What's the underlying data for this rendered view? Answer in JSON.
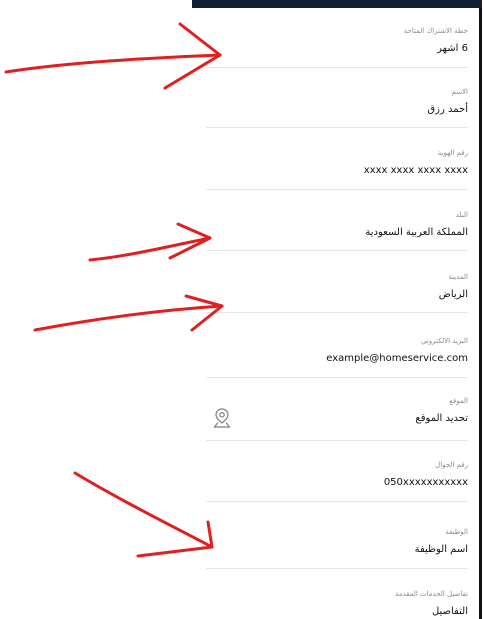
{
  "form": {
    "fields": [
      {
        "label": "خطة الاشتراك المتاحة",
        "value": "6 اشهر"
      },
      {
        "label": "الاسم",
        "value": "أحمد رزق"
      },
      {
        "label": "رقم الهوية",
        "value": "xxxx  xxxx  xxxx  xxxx"
      },
      {
        "label": "البلد",
        "value": "المملكة العربية السعودية"
      },
      {
        "label": "المدينة",
        "value": "الرياض"
      },
      {
        "label": "البريد الالكتروني",
        "value": "example@homeservice.com"
      },
      {
        "label": "الموقع",
        "value": "تحديد الموقع"
      },
      {
        "label": "رقم الجوال",
        "value": "050xxxxxxxxxxx"
      },
      {
        "label": "الوظيفة",
        "value": "اسم الوظيفة"
      },
      {
        "label": "تفاصيل الخدمات المقدمة",
        "value": "التفاصيل"
      }
    ]
  },
  "icons": {
    "location": "map-pin-icon"
  },
  "colors": {
    "topbar": "#0f2036",
    "arrows": "#e02020",
    "label": "#8a8a8a"
  }
}
